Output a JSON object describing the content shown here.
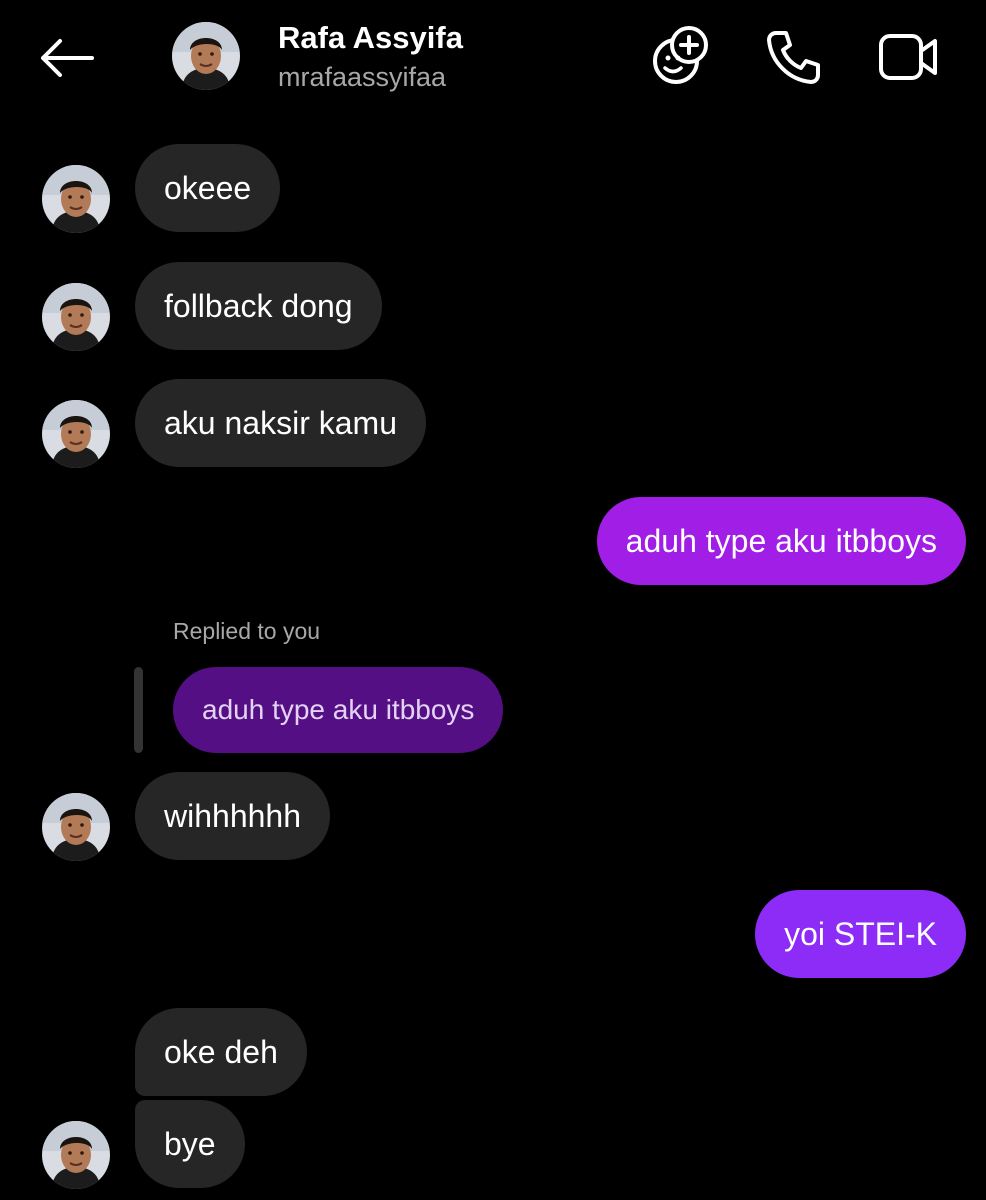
{
  "header": {
    "name": "Rafa Assyifa",
    "username": "mrafaassyifaa"
  },
  "icons": {
    "back": "arrow-left-icon",
    "effects": "face-add-icon",
    "call": "phone-icon",
    "video": "video-camera-icon",
    "avatar": "profile-avatar-icon"
  },
  "colors": {
    "background": "#000000",
    "incoming_bubble": "#262626",
    "outgoing_bubble": "#a11ee6",
    "outgoing_bubble_alt": "#8c2cf6",
    "reply_bubble": "#550f85",
    "secondary_text": "#a8a8a8"
  },
  "messages": [
    {
      "from": "them",
      "text": "okeee"
    },
    {
      "from": "them",
      "text": "follback dong"
    },
    {
      "from": "them",
      "text": "aku naksir kamu"
    },
    {
      "from": "me",
      "text": "aduh type aku itbboys"
    },
    {
      "from": "them",
      "text": "wihhhhhh",
      "reply_label": "Replied to you",
      "reply_quote": "aduh type aku itbboys"
    },
    {
      "from": "me",
      "text": "yoi STEI-K"
    },
    {
      "from": "them",
      "text": "oke deh"
    },
    {
      "from": "them",
      "text": "bye"
    }
  ]
}
